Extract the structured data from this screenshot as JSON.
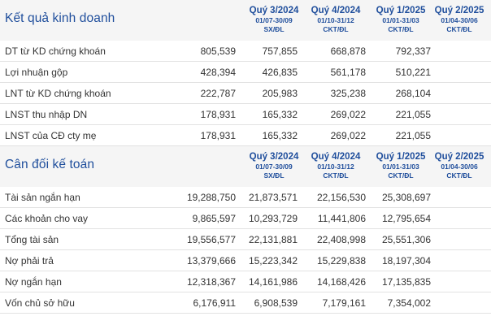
{
  "columns": [
    {
      "quarter": "Quý 3/2024",
      "range": "01/07-30/09",
      "type": "SX/ĐL"
    },
    {
      "quarter": "Quý 4/2024",
      "range": "01/10-31/12",
      "type": "CKT/ĐL"
    },
    {
      "quarter": "Quý 1/2025",
      "range": "01/01-31/03",
      "type": "CKT/ĐL"
    },
    {
      "quarter": "Quý 2/2025",
      "range": "01/04-30/06",
      "type": "CKT/ĐL"
    }
  ],
  "kqkd": {
    "title": "Kết quả kinh doanh",
    "rows": [
      {
        "label": "DT từ KD chứng khoán",
        "values": [
          "805,539",
          "757,855",
          "668,878",
          "792,337"
        ]
      },
      {
        "label": "Lợi nhuận gộp",
        "values": [
          "428,394",
          "426,835",
          "561,178",
          "510,221"
        ]
      },
      {
        "label": "LNT từ KD chứng khoán",
        "values": [
          "222,787",
          "205,983",
          "325,238",
          "268,104"
        ]
      },
      {
        "label": "LNST thu nhập DN",
        "values": [
          "178,931",
          "165,332",
          "269,022",
          "221,055"
        ]
      },
      {
        "label": "LNST của CĐ cty mẹ",
        "values": [
          "178,931",
          "165,332",
          "269,022",
          "221,055"
        ]
      }
    ]
  },
  "cdkt": {
    "title": "Cân đối kế toán",
    "rows": [
      {
        "label": "Tài sản ngắn hạn",
        "values": [
          "19,288,750",
          "21,873,571",
          "22,156,530",
          "25,308,697"
        ]
      },
      {
        "label": "Các khoản cho vay",
        "values": [
          "9,865,597",
          "10,293,729",
          "11,441,806",
          "12,795,654"
        ]
      },
      {
        "label": "Tổng tài sản",
        "values": [
          "19,556,577",
          "22,131,881",
          "22,408,998",
          "25,551,306"
        ]
      },
      {
        "label": "Nợ phải trả",
        "values": [
          "13,379,666",
          "15,223,342",
          "15,229,838",
          "18,197,304"
        ]
      },
      {
        "label": "Nợ ngắn hạn",
        "values": [
          "12,318,367",
          "14,161,986",
          "14,168,426",
          "17,135,835"
        ]
      },
      {
        "label": "Vốn chủ sở hữu",
        "values": [
          "6,176,911",
          "6,908,539",
          "7,179,161",
          "7,354,002"
        ]
      }
    ]
  }
}
